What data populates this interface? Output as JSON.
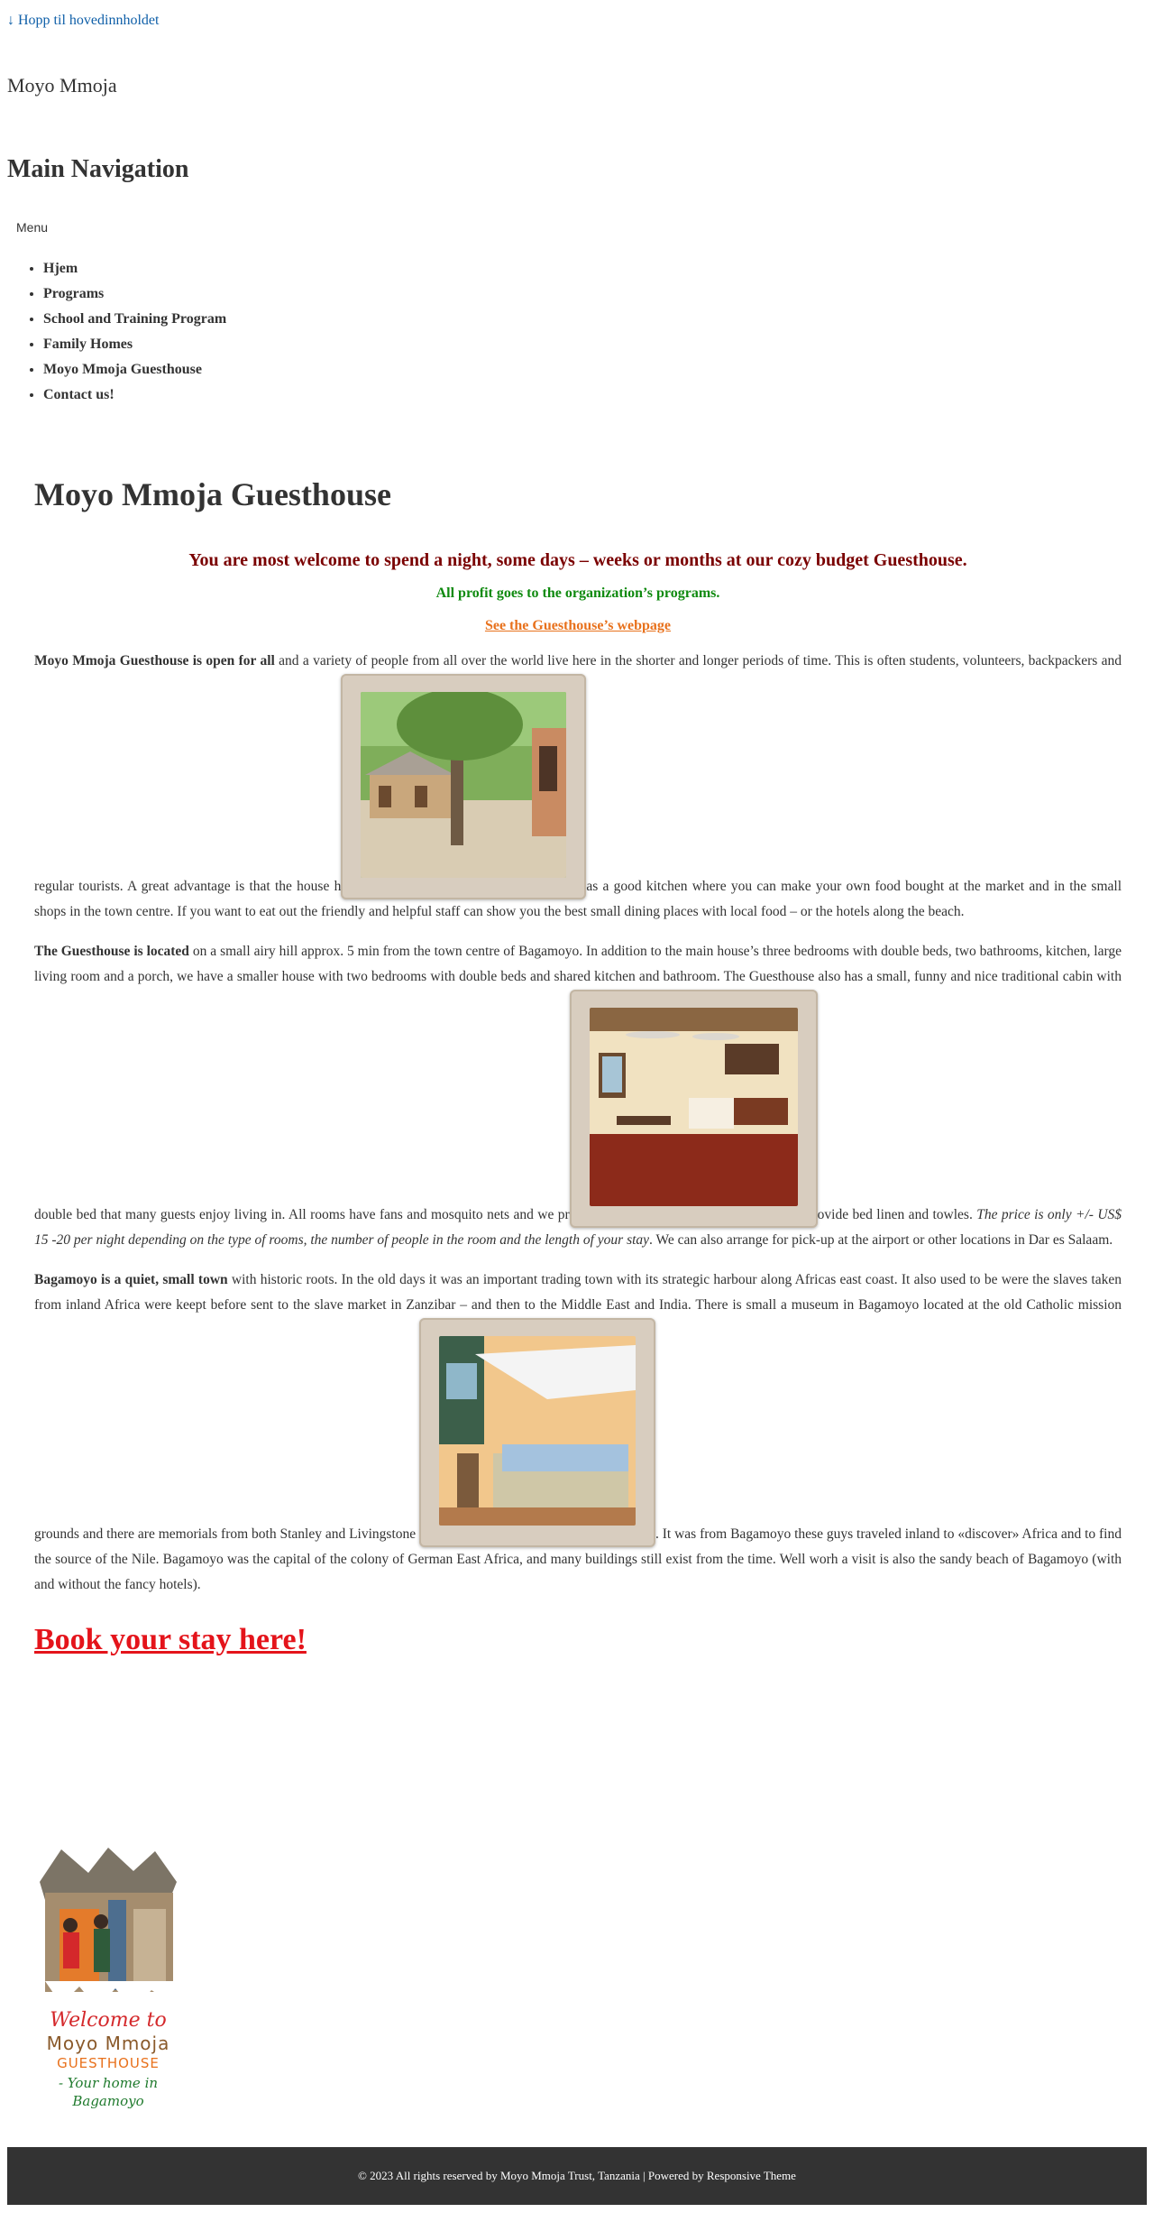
{
  "skip_link": "↓ Hopp til hovedinnholdet",
  "site_title": "Moyo Mmoja",
  "nav": {
    "heading": "Main Navigation",
    "menu_label": "Menu",
    "items": [
      "Hjem",
      "Programs",
      "School and Training Program",
      "Family Homes",
      "Moyo Mmoja Guesthouse",
      "Contact us!"
    ]
  },
  "page": {
    "title": "Moyo Mmoja Guesthouse",
    "welcome": "You are most welcome to spend a night, some days – weeks or months at our cozy budget Guesthouse.",
    "profit": "All profit goes to the organization’s programs.",
    "guesthouse_link": "See the Guesthouse’s webpage",
    "p1_bold": "Moyo Mmoja Guesthouse is open for all",
    "p1_a": " and a variety of people from all over the world live here in the shorter and longer periods of time. This is often students, volunteers, backpackers and regular tourists. A great advantage is that the house h",
    "p1_b": "as a good kitchen where you can make your own food bought at the market and in the small shops in the town centre. If you want to eat out the friendly and helpful staff can show you the best small dining places with local food – or the hotels along the beach.",
    "p2_bold": "The Guesthouse is located",
    "p2_a": " on a small airy hill approx. 5 min from the town centre of Bagamoyo. In addition to the main house’s three bedrooms with double beds, two bathrooms, kitchen, large living room and a porch, we have a smaller house with two bedrooms with double beds and shared kitchen and bathroom. The Guesthouse also has a small, funny and nice traditional cabin with double bed that many guests enjoy living in. All rooms have fans and mosquito nets and we pr",
    "p2_b": "ovide bed linen and towles. ",
    "p2_italic": "The price is only +/- US$ 15 -20 per night depending on the type of rooms, the number of people in the room and the length of your stay",
    "p2_c": ". We can also arrange for pick-up at the airport or other locations in Dar es Salaam.",
    "p3_bold": "Bagamoyo is a quiet, small town",
    "p3_a": " with historic roots. In the old days it was an important trading town with its strategic harbour along Africas east coast. It also used to be were the slaves taken from inland Africa were keept before sent to the slave market in Zanzibar – and then to the Middle East and India. There is small a museum in Bagamoyo located at the old Catholic mission grounds and there are memorials from both Stanley and Livingstone ",
    "p3_b": ". It was from Bagamoyo these guys traveled inland to «discover» Africa and to find the source of the Nile. Bagamoyo was the capital of the colony of German East Africa, and many buildings still exist from the time. Well worh a visit is also the sandy beach of Bagamoyo (with and without the fancy hotels).",
    "book_link": "Book your stay here!"
  },
  "logo": {
    "line1": "Welcome to",
    "line2": "Moyo Mmoja",
    "line3": "GUESTHOUSE",
    "line4": "- Your home in",
    "line5": "Bagamoyo"
  },
  "footer": {
    "text": "© 2023 All rights reserved by Moyo Mmoja Trust, Tanzania | Powered by ",
    "theme_link": "Responsive Theme"
  },
  "colors": {
    "welcome": "#7a0000",
    "profit": "#0f8a0f",
    "guesthouse_link": "#e8711c",
    "book_link": "#e4141b",
    "footer_bg": "#333333"
  }
}
